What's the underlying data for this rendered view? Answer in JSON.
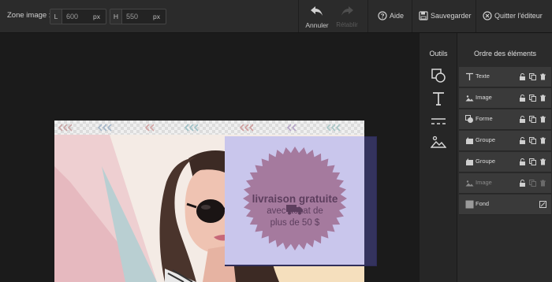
{
  "toolbar": {
    "zone_label": "Zone image :",
    "width_prefix": "L",
    "width_value": "600",
    "width_unit": "px",
    "height_prefix": "H",
    "height_value": "550",
    "height_unit": "px",
    "undo_label": "Annuler",
    "redo_label": "Rétablir",
    "help_label": "Aide",
    "save_label": "Sauvegarder",
    "quit_label": "Quitter l'éditeur"
  },
  "canvas": {
    "promo_title": "livraison gratuite",
    "promo_line1": "avec achat de",
    "promo_line2": "plus de 50 $"
  },
  "tools": {
    "title": "Outils",
    "items": [
      "shapes-icon",
      "text-icon",
      "lines-icon",
      "image-icon"
    ]
  },
  "layers": {
    "title": "Ordre des éléments",
    "items": [
      {
        "label": "Texte",
        "icon": "text-icon"
      },
      {
        "label": "Image",
        "icon": "image-icon"
      },
      {
        "label": "Forme",
        "icon": "shape-icon"
      },
      {
        "label": "Groupe",
        "icon": "group-icon"
      },
      {
        "label": "Groupe",
        "icon": "group-icon"
      },
      {
        "label": "Image",
        "icon": "image-icon"
      },
      {
        "label": "Fond",
        "icon": "background-icon"
      }
    ]
  },
  "colors": {
    "toolbar_bg": "#2b2b2b",
    "canvas_bg": "#1b1b1b",
    "promo_bg": "#c9c6ec",
    "badge": "#a57a9e",
    "promo_text": "#5d3e5e"
  }
}
